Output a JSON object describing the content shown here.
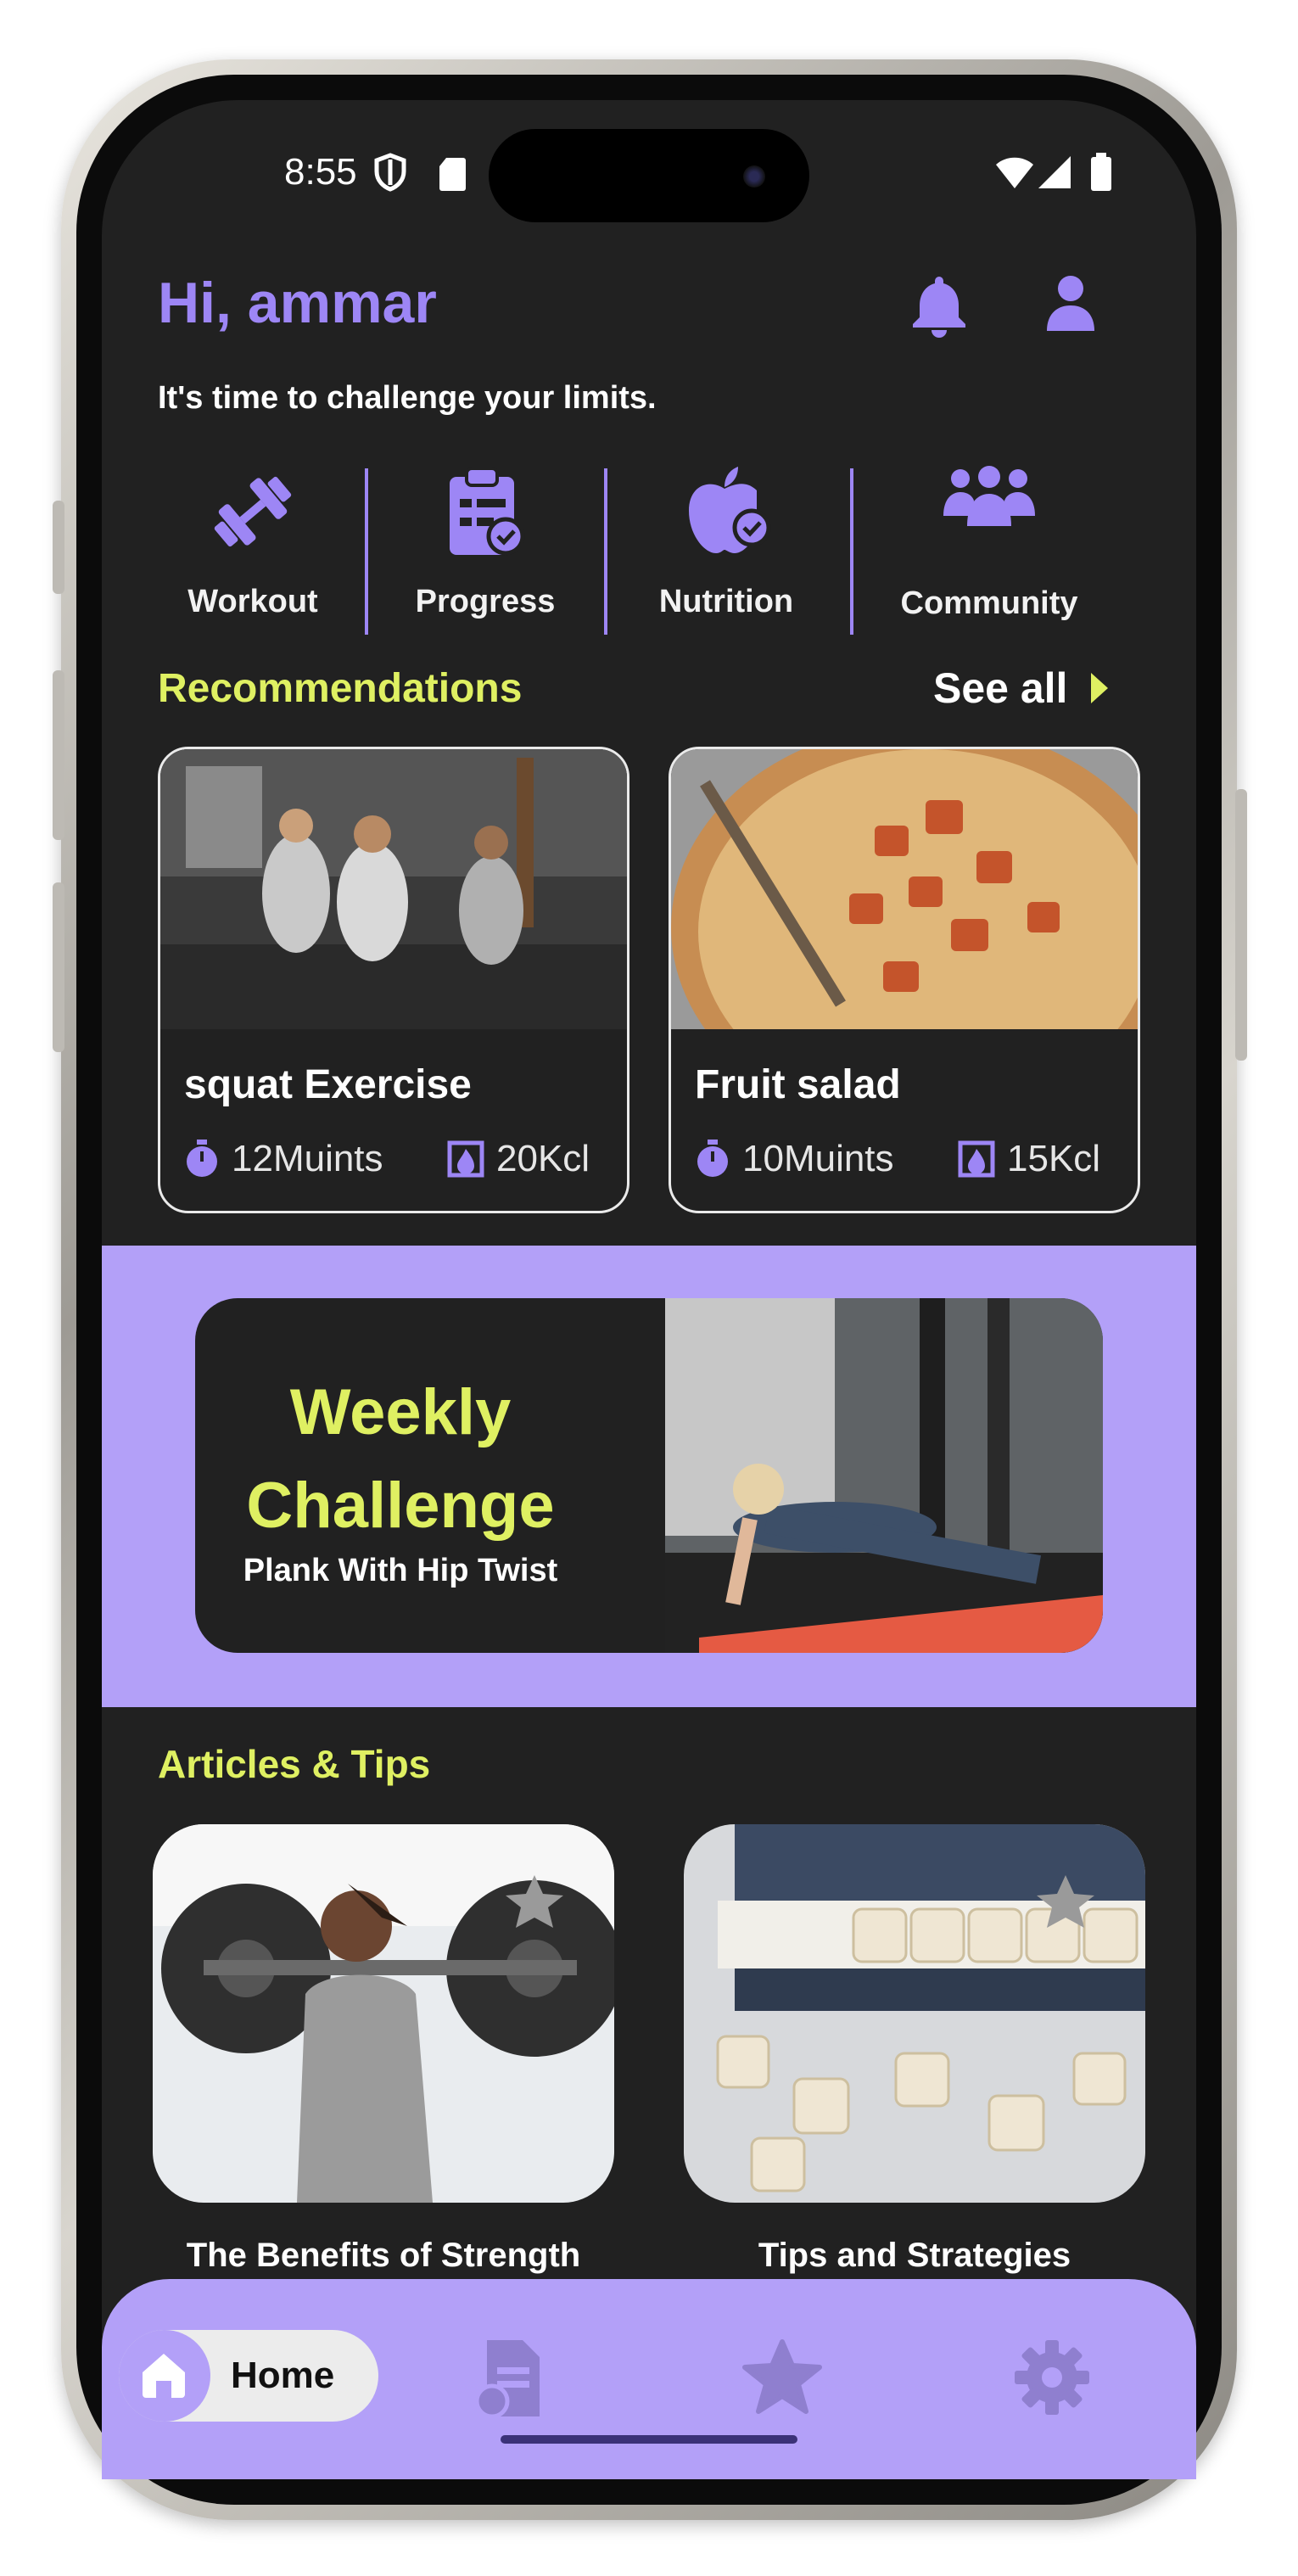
{
  "status_bar": {
    "time": "8:55"
  },
  "header": {
    "greeting": "Hi, ammar",
    "subtitle": "It's time to challenge your limits."
  },
  "categories": [
    {
      "label": "Workout",
      "icon": "dumbbell-icon"
    },
    {
      "label": "Progress",
      "icon": "clipboard-check-icon"
    },
    {
      "label": "Nutrition",
      "icon": "apple-check-icon"
    },
    {
      "label": "Community",
      "icon": "group-icon"
    }
  ],
  "recommendations": {
    "title": "Recommendations",
    "see_all": "See all",
    "items": [
      {
        "title": "squat Exercise",
        "duration": "12Muints",
        "calories": "20Kcl"
      },
      {
        "title": "Fruit salad",
        "duration": "10Muints",
        "calories": "15Kcl"
      }
    ]
  },
  "weekly": {
    "title_line1": "Weekly",
    "title_line2": "Challenge",
    "subtitle": "Plank With Hip Twist"
  },
  "articles": {
    "title": "Articles & Tips",
    "items": [
      {
        "title": "The Benefits of Strength"
      },
      {
        "title": "Tips and Strategies"
      }
    ]
  },
  "nav": {
    "home_label": "Home",
    "items": [
      "home-icon",
      "document-icon",
      "star-icon",
      "gear-icon"
    ]
  },
  "colors": {
    "background": "#212121",
    "accent_purple": "#9d86f5",
    "band_purple": "#b3a0f8",
    "accent_yellow": "#dff062"
  }
}
